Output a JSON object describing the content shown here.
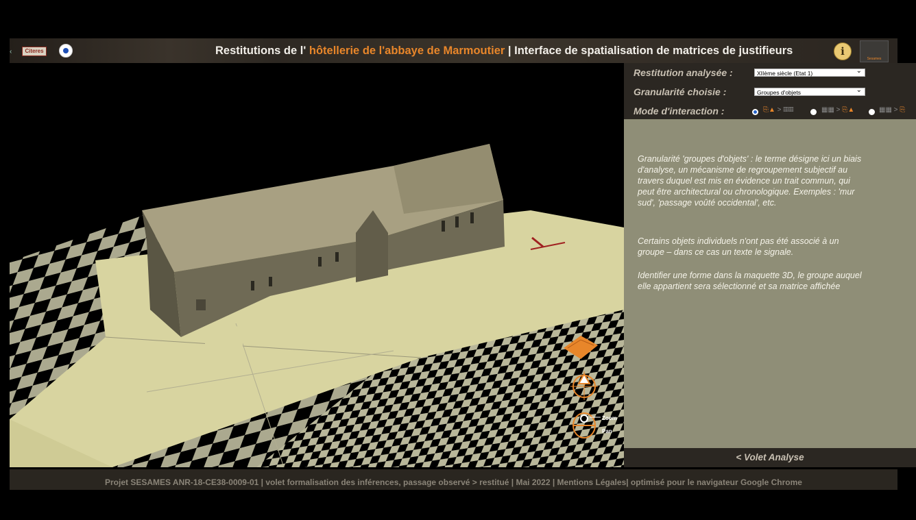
{
  "header": {
    "title_prefix": "Restitutions de l'",
    "title_accent": "hôtellerie de l'abbaye de Marmoutier",
    "title_suffix": " | Interface de spatialisation de matrices de justifieurs",
    "logo_left_text": "Citeres",
    "left_edge_mark": "‹",
    "info_label": "i",
    "logo_right_text": "Sesames"
  },
  "settings": {
    "restitution_label": "Restitution analysée :",
    "restitution_value": "XIIème siècle (Etat 1)",
    "granularite_label": "Granularité choisie :",
    "granularite_value": "Groupes d'objets",
    "mode_label": "Mode d'interaction :",
    "modes": [
      {
        "icon": "group-to-matrix-icon",
        "glyph_a": "⎘▲",
        "sep": " > ",
        "glyph_b": "▦▦",
        "selected": true
      },
      {
        "icon": "matrix-to-group-icon",
        "glyph_a": "▦▦",
        "sep": " > ",
        "glyph_b": "⎘▲",
        "selected": false
      },
      {
        "icon": "matrix-to-group-alt-icon",
        "glyph_a": "▦▦",
        "sep": " > ",
        "glyph_b": "⎘",
        "selected": false
      }
    ]
  },
  "description": {
    "para1": "Granularité 'groupes d'objets' : le terme désigne ici un biais d'analyse, un mécanisme de regroupement subjectif au travers duquel est mis en évidence un trait commun, qui peut être architectural ou chronologique. Exemples : 'mur sud', 'passage voûté occidental', etc.",
    "para2": "Certains objets individuels n'ont pas été associé à un groupe – dans ce cas un texte le signale.",
    "para3": "Identifier une forme dans la maquette 3D, le groupe auquel elle appartient sera sélectionné et sa matrice affichée"
  },
  "volet_label": "< Volet Analyse",
  "nav": {
    "zoom_label": "Zoom",
    "pan_label": "Pan"
  },
  "footer": "Projet SESAMES ANR-18-CE38-0009-01 | volet formalisation des inférences, passage observé > restitué | Mai 2022 | Mentions Légales| optimisé pour le navigateur Google Chrome",
  "colors": {
    "accent": "#e8862a",
    "panel_dark": "#2b2722",
    "panel_olive": "#8f8e77",
    "ground": "#d8d4a0",
    "building": "#7a745c"
  }
}
